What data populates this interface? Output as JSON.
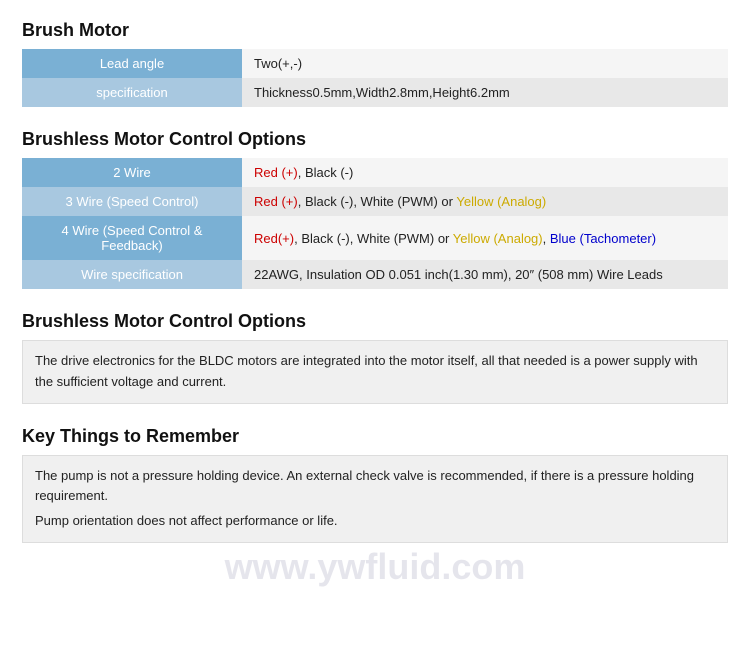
{
  "sections": [
    {
      "id": "brush-motor",
      "title": "Brush Motor",
      "type": "table",
      "rows": [
        {
          "label": "Lead angle",
          "value_plain": "Two(+,-)",
          "value_html": "Two(+,-)"
        },
        {
          "label": "specification",
          "value_plain": "Thickness0.5mm,Width2.8mm,Height6.2mm",
          "value_html": "Thickness0.5mm,Width2.8mm,Height6.2mm"
        }
      ]
    },
    {
      "id": "brushless-motor-control-options-1",
      "title": "Brushless Motor Control Options",
      "type": "table",
      "rows": [
        {
          "label": "2 Wire",
          "value_plain": "Red (+), Black (-)"
        },
        {
          "label": "3 Wire (Speed Control)",
          "value_plain": "Red (+), Black (-), White (PWM) or Yellow (Analog)"
        },
        {
          "label": "4 Wire (Speed Control & Feedback)",
          "value_plain": "Red(+), Black (-), White (PWM) or Yellow (Analog), Blue (Tachometer)"
        },
        {
          "label": "Wire specification",
          "value_plain": "22AWG, Insulation OD 0.051 inch(1.30 mm), 20\" (508 mm) Wire Leads"
        }
      ]
    },
    {
      "id": "brushless-motor-control-options-2",
      "title": "Brushless Motor Control Options",
      "type": "text",
      "content": "The drive electronics for the BLDC motors are integrated into the motor itself, all that needed is a power supply with the sufficient voltage and current."
    },
    {
      "id": "key-things",
      "title": "Key Things to Remember",
      "type": "text",
      "lines": [
        "The pump is not a pressure holding device. An external check valve is recommended, if there is a pressure holding requirement.",
        "Pump orientation does not affect performance or life."
      ]
    }
  ],
  "watermark": "www.ywfluid.com"
}
